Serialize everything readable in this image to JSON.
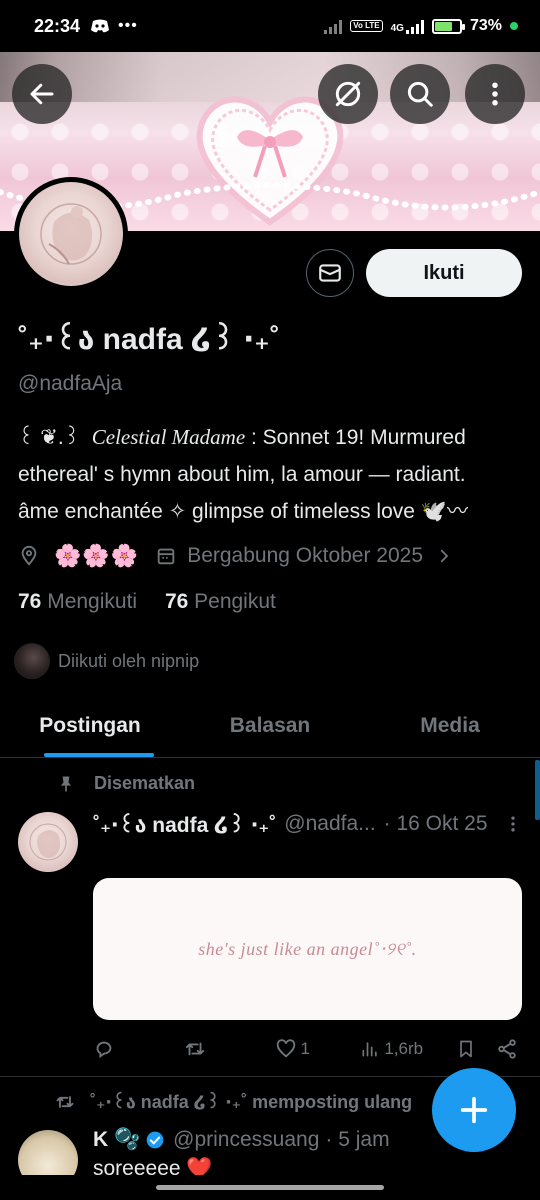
{
  "status_bar": {
    "time": "22:34",
    "network": "4G",
    "volte": "Vo LTE",
    "battery": "73%",
    "battery_level": 0.73
  },
  "header": {
    "back_icon": "arrow-left-icon",
    "actions": [
      "spam-off-icon",
      "search-icon",
      "more-vertical-icon"
    ]
  },
  "profile": {
    "display_name": "˚₊‧꒰ა nadfa ໒꒱ ‧₊˚",
    "handle": "@nadfaAja",
    "follow_label": "Ikuti",
    "bio_line1_prefix": "꒰ ❦.꒱",
    "bio_line1_italic": "Celestial Madame",
    "bio_line1_rest": ": Sonnet 19! Murmured",
    "bio_line2": "ethereal' s hymn about him, la amour — radiant.",
    "bio_line3": "âme enchantée ✧ glimpse of timeless love 🕊️〰",
    "location": "🌸🌸🌸",
    "joined": "Bergabung Oktober 2025",
    "following_count": "76",
    "following_label": "Mengikuti",
    "followers_count": "76",
    "followers_label": "Pengikut",
    "followed_by": "Diikuti oleh nipnip"
  },
  "tabs": [
    {
      "label": "Postingan",
      "active": true
    },
    {
      "label": "Balasan",
      "active": false
    },
    {
      "label": "Media",
      "active": false
    }
  ],
  "pinned_post": {
    "pinned_label": "Disematkan",
    "author_name": "˚₊‧꒰ა nadfa ໒꒱ ‧₊˚",
    "author_handle": "@nadfa...",
    "date": "· 16 Okt 25",
    "media_text": "she's just like an angel˚‧୨୧˚.",
    "likes": "1",
    "views": "1,6rb"
  },
  "repost": {
    "label": "˚₊‧꒰ა nadfa ໒꒱ ‧₊˚ memposting ulang",
    "author_name": "K 🫧",
    "author_handle": "@princessuang",
    "time": "· 5 jam",
    "text": "soreeeee ❤️"
  },
  "colors": {
    "accent": "#1d9bf0",
    "muted": "#71767b",
    "text": "#e7e9ea",
    "border": "#2f3336"
  }
}
